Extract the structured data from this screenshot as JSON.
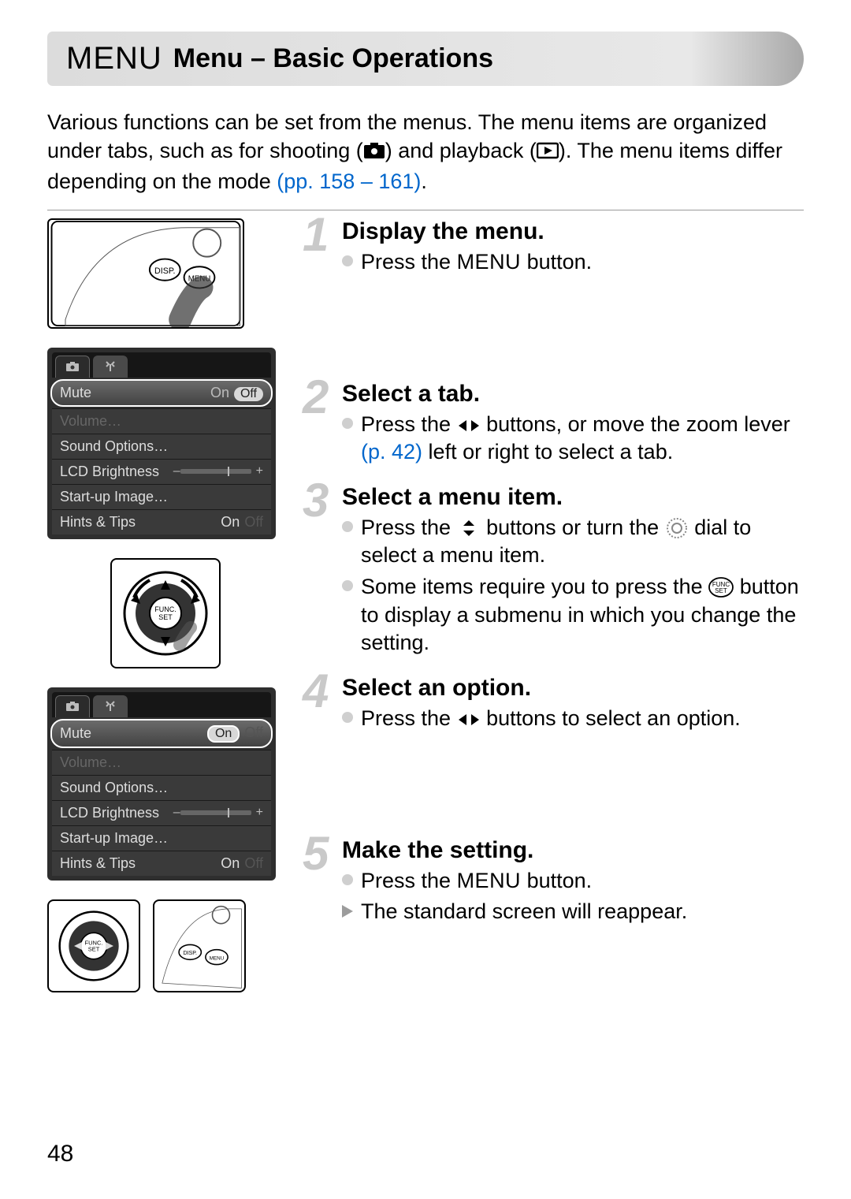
{
  "title": {
    "menu_label": "MENU",
    "text": "Menu – Basic Operations"
  },
  "intro": {
    "line1a": "Various functions can be set from the menus. The menu items are organized under tabs, such as for shooting (",
    "line1b": ") and playback (",
    "line1c": "). The menu items differ depending on the mode ",
    "pages_link": "(pp. 158 – 161)",
    "period": "."
  },
  "steps": [
    {
      "num": "1",
      "title": "Display the menu.",
      "bullets": [
        {
          "pre": "Press the ",
          "mid": "MENU",
          "post": " button."
        }
      ]
    },
    {
      "num": "2",
      "title": "Select a tab.",
      "bullets": [
        {
          "pre": "Press the ",
          "icon": "lr",
          "post1": " buttons, or move the zoom lever ",
          "link": "(p. 42)",
          "post2": " left or right to select a tab."
        }
      ]
    },
    {
      "num": "3",
      "title": "Select a menu item.",
      "bullets": [
        {
          "pre": "Press the ",
          "icon": "ud",
          "mid": " buttons or turn the ",
          "icon2": "dial",
          "post": " dial to select a menu item."
        },
        {
          "pre": "Some items require you to press the ",
          "icon": "func",
          "post": " button to display a submenu in which you change the setting."
        }
      ]
    },
    {
      "num": "4",
      "title": "Select an option.",
      "bullets": [
        {
          "pre": "Press the ",
          "icon": "lr",
          "post": " buttons to select an option."
        }
      ]
    },
    {
      "num": "5",
      "title": "Make the setting.",
      "bullets": [
        {
          "pre": "Press the ",
          "mid": "MENU",
          "post": " button."
        },
        {
          "kind": "tri",
          "text": "The standard screen will reappear."
        }
      ]
    }
  ],
  "lcd1": {
    "rows": [
      {
        "label": "Mute",
        "val_on": "On",
        "val_off": "Off",
        "highlight": true,
        "off_selected": true
      },
      {
        "label": "Volume…",
        "dim": true
      },
      {
        "label": "Sound Options…"
      },
      {
        "label": "LCD Brightness",
        "slider": true
      },
      {
        "label": "Start-up Image…"
      },
      {
        "label": "Hints & Tips",
        "val_on": "On",
        "val_off": "Off"
      }
    ]
  },
  "lcd2": {
    "rows": [
      {
        "label": "Mute",
        "val_on": "On",
        "val_off": "Off",
        "highlight": true,
        "on_selected": true
      },
      {
        "label": "Volume…",
        "dim": true
      },
      {
        "label": "Sound Options…"
      },
      {
        "label": "LCD Brightness",
        "slider": true
      },
      {
        "label": "Start-up Image…"
      },
      {
        "label": "Hints & Tips",
        "val_on": "On",
        "val_off": "Off"
      }
    ]
  },
  "page_number": "48"
}
